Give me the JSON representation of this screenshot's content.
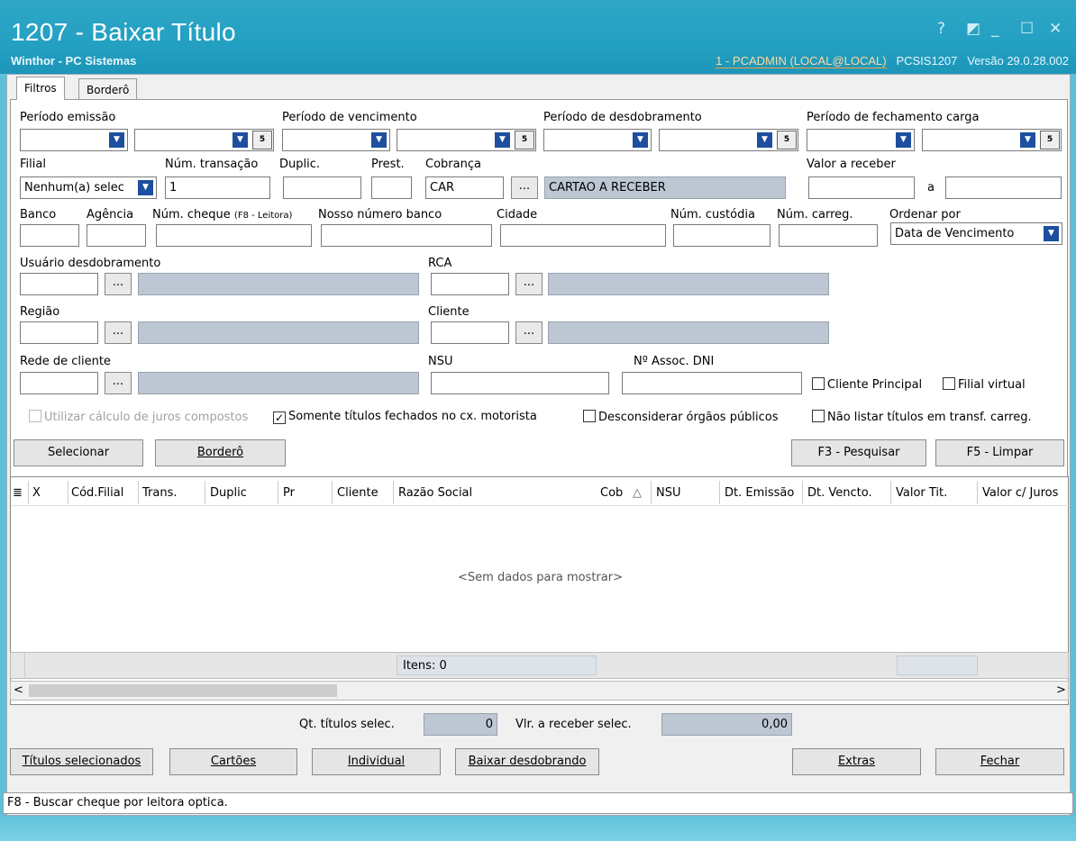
{
  "window": {
    "title": "1207 - Baixar Título",
    "subtitle": "Winthor - PC Sistemas",
    "user": "1 - PCADMIN (LOCAL@LOCAL)",
    "program": "PCSIS1207",
    "version": "Versão  29.0.28.002",
    "help": "?",
    "minimize": "_",
    "restore": "◩",
    "maximize": "☐",
    "close": "✕"
  },
  "tabs": [
    "Filtros",
    "Borderô"
  ],
  "filters": {
    "periodo_emissao": "Período emissão",
    "periodo_vencimento": "Período de vencimento",
    "periodo_desdobramento": "Período de desdobramento",
    "periodo_fechamento": "Período de fechamento carga",
    "filial": "Filial",
    "filial_value": "Nenhum(a) selec",
    "num_transacao": "Núm. transação",
    "num_transacao_value": "1",
    "duplic": "Duplic.",
    "prest": "Prest.",
    "cobranca": "Cobrança",
    "cobranca_value": "CAR",
    "cobranca_desc": "CARTAO A RECEBER",
    "valor_receber": "Valor a receber",
    "valor_a": "a",
    "banco": "Banco",
    "agencia": "Agência",
    "num_cheque": "Núm. cheque",
    "num_cheque_hint": "(F8 - Leitora)",
    "nosso_numero": "Nosso número banco",
    "cidade": "Cidade",
    "num_custodia": "Núm. custódia",
    "num_carreg": "Núm. carreg.",
    "ordenar_por": "Ordenar por",
    "ordenar_value": "Data de Vencimento",
    "usuario_desdobramento": "Usuário desdobramento",
    "rca": "RCA",
    "regiao": "Região",
    "cliente": "Cliente",
    "rede_cliente": "Rede de cliente",
    "nsu": "NSU",
    "assoc_dni": "Nº Assoc. DNI",
    "dots": "...",
    "cal_icon": "5"
  },
  "checks": {
    "cliente_principal": "Cliente Principal",
    "filial_virtual": "Filial virtual",
    "juros_compostos": "Utilizar cálculo de juros compostos",
    "somente_fechados": "Somente títulos fechados no cx. motorista",
    "desconsiderar": "Desconsiderar órgãos públicos",
    "nao_listar": "Não listar títulos em transf. carreg.",
    "checkmark": "✓"
  },
  "actions": {
    "selecionar": "Selecionar",
    "bordero": "Borderô",
    "pesquisar": "F3 - Pesquisar",
    "limpar": "F5 - Limpar"
  },
  "grid": {
    "columns": [
      "X",
      "Cód.Filial",
      "Trans.",
      "Duplic",
      "Pr",
      "Cliente",
      "Razão Social",
      "Cob",
      "NSU",
      "Dt. Emissão",
      "Dt. Vencto.",
      "Valor Tit.",
      "Valor c/ Juros"
    ],
    "sort_icon": "△",
    "menu_icon": "≣",
    "empty": "<Sem dados para mostrar>",
    "items": "Itens: 0",
    "scroll_left": "<",
    "scroll_right": ">"
  },
  "summary": {
    "qt_label": "Qt. títulos selec.",
    "qt_value": "0",
    "vlr_label": "Vlr. a receber selec.",
    "vlr_value": "0,00"
  },
  "bottom": {
    "titulos": "Títulos selecionados",
    "cartoes": "Cartões",
    "individual": "Individual",
    "baixar": "Baixar desdobrando",
    "extras": "Extras",
    "fechar": "Fechar"
  },
  "status": "F8 - Buscar cheque por leitora optica."
}
